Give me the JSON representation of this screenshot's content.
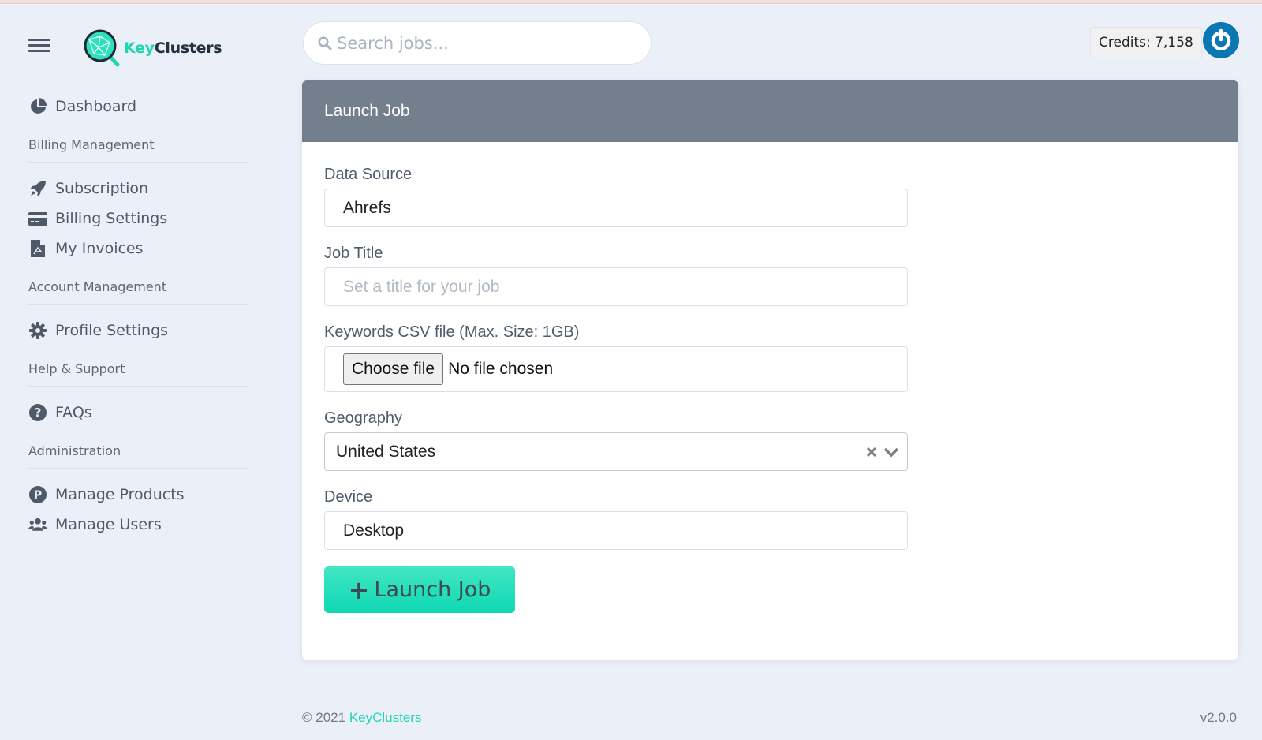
{
  "app": {
    "brand_key": "Key",
    "brand_rest": "Clusters",
    "accent_color": "#1fd6b0",
    "header_color": "#747f8e",
    "power_color": "#0a77b3"
  },
  "header": {
    "search_placeholder": "Search jobs...",
    "credits_label": "Credits: 7,158"
  },
  "sidebar": {
    "items": [
      {
        "type": "item",
        "label": "Dashboard",
        "icon": "pie-chart-icon"
      },
      {
        "type": "section",
        "label": "Billing Management"
      },
      {
        "type": "item",
        "label": "Subscription",
        "icon": "rocket-icon"
      },
      {
        "type": "item",
        "label": "Billing Settings",
        "icon": "credit-card-icon"
      },
      {
        "type": "item",
        "label": "My Invoices",
        "icon": "pdf-file-icon"
      },
      {
        "type": "section",
        "label": "Account Management"
      },
      {
        "type": "item",
        "label": "Profile Settings",
        "icon": "gear-icon"
      },
      {
        "type": "section",
        "label": "Help & Support"
      },
      {
        "type": "item",
        "label": "FAQs",
        "icon": "question-circle-icon"
      },
      {
        "type": "section",
        "label": "Administration"
      },
      {
        "type": "item",
        "label": "Manage Products",
        "icon": "product-p-icon"
      },
      {
        "type": "item",
        "label": "Manage Users",
        "icon": "users-icon"
      }
    ]
  },
  "form": {
    "title": "Launch Job",
    "data_source_label": "Data Source",
    "data_source_value": "Ahrefs",
    "job_title_label": "Job Title",
    "job_title_placeholder": "Set a title for your job",
    "csv_label": "Keywords CSV file (Max. Size: 1GB)",
    "choose_file_label": "Choose file",
    "file_status": "No file chosen",
    "geography_label": "Geography",
    "geography_value": "United States",
    "device_label": "Device",
    "device_value": "Desktop",
    "launch_button_label": "Launch Job"
  },
  "footer": {
    "copyright": "© 2021",
    "brand_link": "KeyClusters",
    "version": "v2.0.0"
  }
}
